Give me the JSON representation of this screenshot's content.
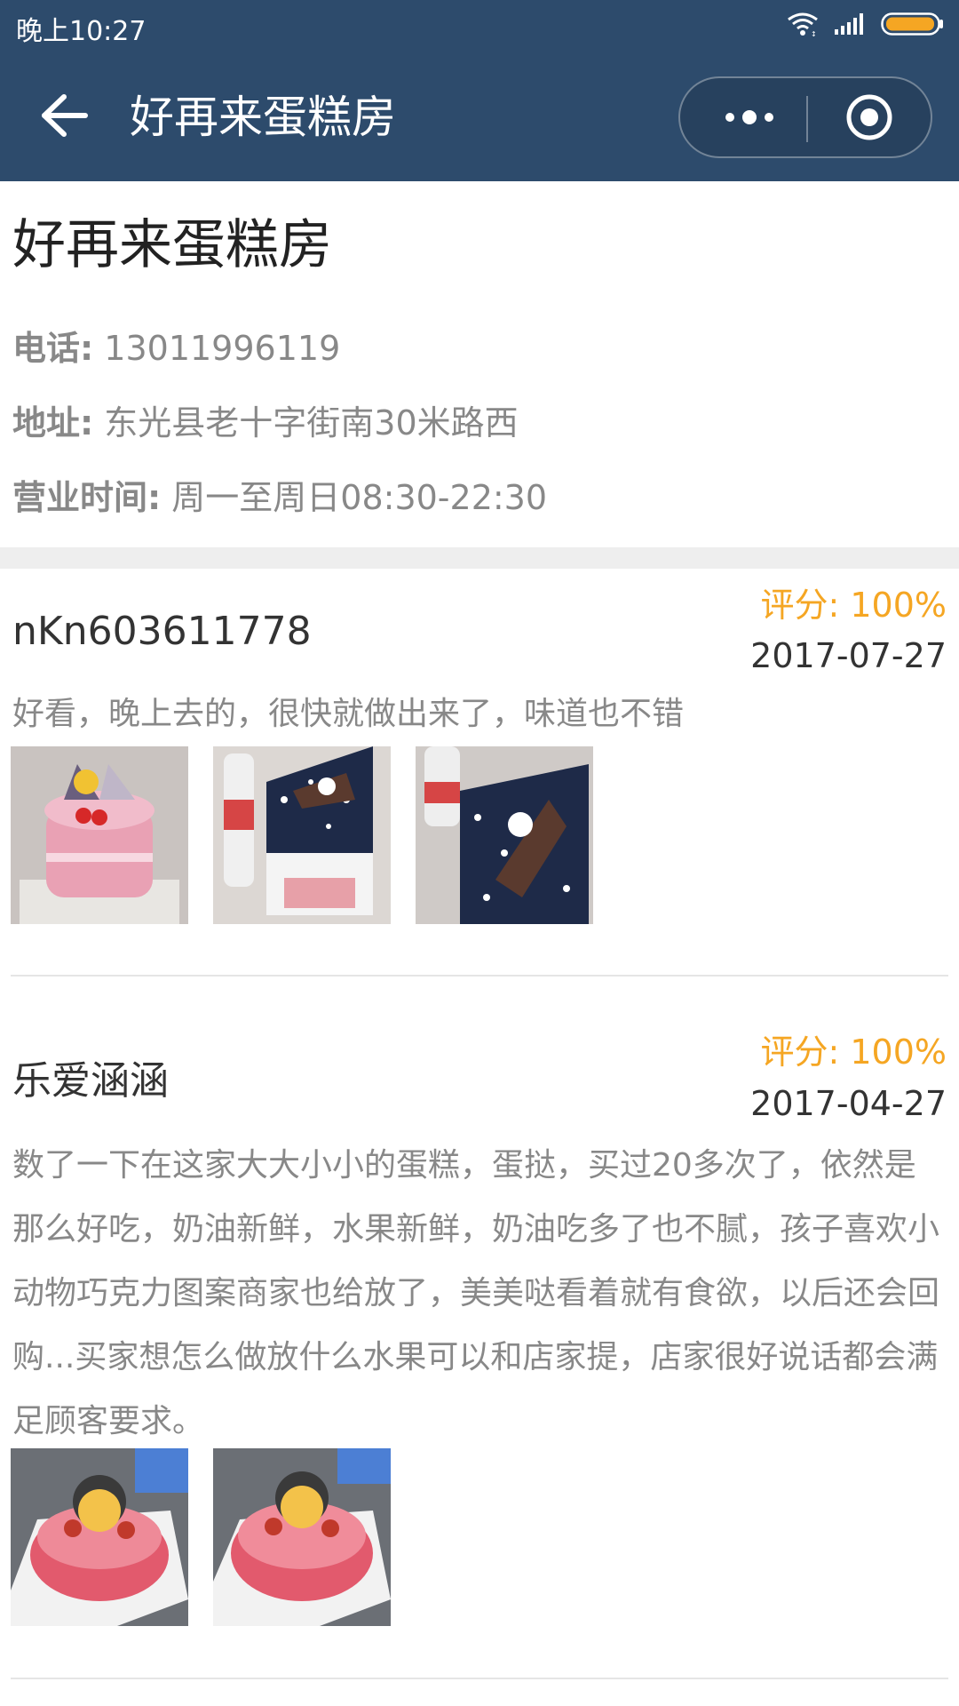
{
  "status_bar": {
    "time": "晚上10:27"
  },
  "nav": {
    "title": "好再来蛋糕房"
  },
  "shop": {
    "title": "好再来蛋糕房",
    "phone_label": "电话:",
    "phone_value": "13011996119",
    "address_label": "地址:",
    "address_value": "东光县老十字街南30米路西",
    "hours_label": "营业时间:",
    "hours_value": "周一至周日08:30-22:30"
  },
  "reviews": [
    {
      "user": "nKn603611778",
      "score": "评分: 100%",
      "date": "2017-07-27",
      "text": "好看，晚上去的，很快就做出来了，味道也不错"
    },
    {
      "user": "乐爱涵涵",
      "score": "评分: 100%",
      "date": "2017-04-27",
      "text": "数了一下在这家大大小小的蛋糕，蛋挞，买过20多次了，依然是那么好吃，奶油新鲜，水果新鲜，奶油吃多了也不腻，孩子喜欢小动物巧克力图案商家也给放了，美美哒看着就有食欲，以后还会回购...买家想怎么做放什么水果可以和店家提，店家很好说话都会满足顾客要求。"
    }
  ],
  "colors": {
    "nav_bg": "#2d4b6c",
    "score": "#f5a623",
    "battery": "#f5a623"
  }
}
